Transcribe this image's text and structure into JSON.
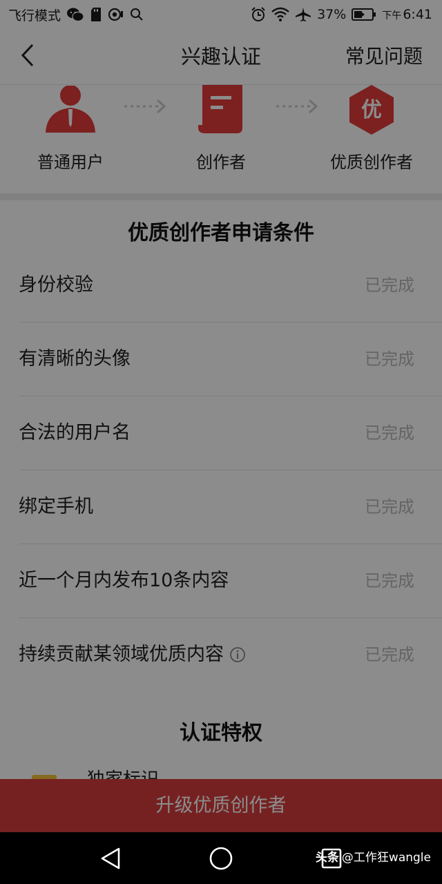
{
  "status_bar": {
    "airplane_mode_label": "飞行模式",
    "battery_percent": "37%",
    "time_prefix": "下午",
    "time": "6:41",
    "icons": [
      "wechat-icon",
      "sd-card-icon",
      "camera-icon",
      "search-icon",
      "alarm-icon",
      "wifi-icon",
      "airplane-icon",
      "battery-icon"
    ]
  },
  "nav": {
    "title": "兴趣认证",
    "faq_label": "常见问题",
    "back_icon": "back-arrow-icon"
  },
  "steps": [
    {
      "label": "普通用户",
      "icon": "user-icon"
    },
    {
      "label": "创作者",
      "icon": "document-icon"
    },
    {
      "label": "优质创作者",
      "icon": "quality-badge-icon",
      "badge_text": "优"
    }
  ],
  "conditions": {
    "title": "优质创作者申请条件",
    "items": [
      {
        "label": "身份校验",
        "status": "已完成"
      },
      {
        "label": "有清晰的头像",
        "status": "已完成"
      },
      {
        "label": "合法的用户名",
        "status": "已完成"
      },
      {
        "label": "绑定手机",
        "status": "已完成"
      },
      {
        "label": "近一个月内发布10条内容",
        "status": "已完成"
      },
      {
        "label": "持续贡献某领域优质内容",
        "status": "已完成",
        "has_info_icon": true
      }
    ]
  },
  "privileges": {
    "title": "认证特权",
    "items": [
      {
        "label": "独家标识"
      }
    ]
  },
  "upgrade_button": {
    "label": "升级优质创作者"
  },
  "watermark": {
    "logo": "头条",
    "handle": "@工作狂wangle"
  },
  "colors": {
    "accent_red": "#d83c3c",
    "status_gray": "#b7b7b7",
    "privilege_gold": "#f2c23a"
  }
}
